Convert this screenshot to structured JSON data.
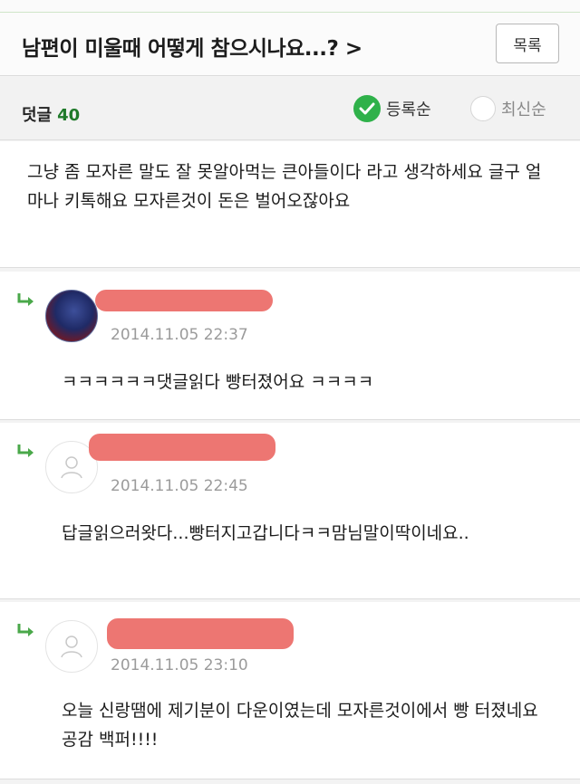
{
  "header": {
    "title": "남편이 미울때 어떻게 참으시나요...? >",
    "list_button": "목록"
  },
  "comment_bar": {
    "label": "덧글",
    "count": "40",
    "sort_registered": "등록순",
    "sort_latest": "최신순"
  },
  "comments": [
    {
      "text": "그냥 좀 모자른 말도 잘 못알아먹는 큰아들이다 라고 생각하세요 글구 얼마나 키톡해요 모자른것이 돈은 벌어오잖아요"
    }
  ],
  "replies": [
    {
      "timestamp": "2014.11.05 22:37",
      "text": "ㅋㅋㅋㅋㅋㅋ댓글읽다 빵터졌어요 ㅋㅋㅋㅋ"
    },
    {
      "timestamp": "2014.11.05 22:45",
      "text": "답글읽으러왓다...빵터지고갑니다ㅋㅋ맘님말이딱이네요.."
    },
    {
      "timestamp": "2014.11.05 23:10",
      "text": "오늘 신랑땜에 제기분이 다운이였는데 모자른것이에서 빵 터졌네요 공감 백퍼!!!!"
    }
  ],
  "colors": {
    "accent_green": "#2fb14a",
    "redaction": "#ec6f6a"
  }
}
